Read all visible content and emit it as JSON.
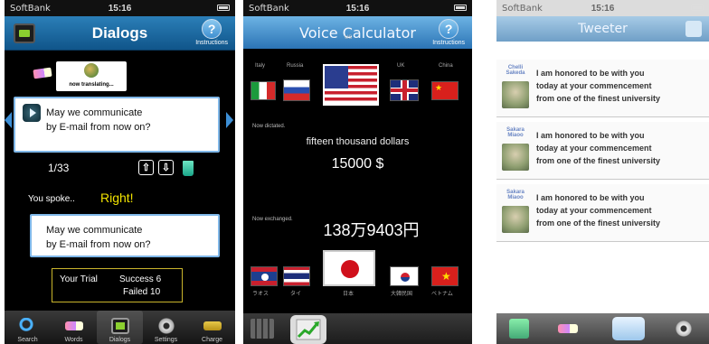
{
  "phone1": {
    "status": {
      "carrier": "SoftBank",
      "time": "15:16"
    },
    "navbar": {
      "title": "Dialogs",
      "help_label": "Instructions",
      "help_glyph": "?"
    },
    "translating_label": "now translating...",
    "dialog_text": [
      "May we communicate",
      "by E-mail from now on?"
    ],
    "counter": "1/33",
    "action_glyphs": {
      "upload": "⇧",
      "download": "⇩"
    },
    "spoke_label": "You spoke..",
    "spoke_result": "Right!",
    "spoken_text": [
      "May we communicate",
      "by E-mail from now on?"
    ],
    "trial": {
      "label": "Your Trial",
      "success": "Success  6",
      "failed": "Failed   10"
    },
    "tabs": [
      {
        "label": "Search",
        "icon": "magnifier-icon",
        "selected": false
      },
      {
        "label": "Words",
        "icon": "pencil-eraser-icon",
        "selected": false
      },
      {
        "label": "Dialogs",
        "icon": "dialog-monitor-icon",
        "selected": true
      },
      {
        "label": "Settings",
        "icon": "gear-icon",
        "selected": false
      },
      {
        "label": "Charge",
        "icon": "money-icon",
        "selected": false
      }
    ]
  },
  "phone2": {
    "status": {
      "carrier": "SoftBank",
      "time": "15:16"
    },
    "navbar": {
      "title": "Voice Calculator",
      "help_label": "Instructions",
      "help_glyph": "?"
    },
    "top_flags": [
      {
        "label": "Italy",
        "country": "italy"
      },
      {
        "label": "Russia",
        "country": "russia"
      },
      {
        "label": "US",
        "country": "usa"
      },
      {
        "label": "UK",
        "country": "uk"
      },
      {
        "label": "China",
        "country": "china"
      }
    ],
    "us_label": "US",
    "now_dictated": "Now dictated.",
    "words": "fifteen thousand dollars",
    "amount": "15000 $",
    "now_exchanged": "Now exchanged.",
    "amount_jp": "138万9403円",
    "bottom_flags": [
      {
        "label": "ラオス",
        "country": "laos"
      },
      {
        "label": "タイ",
        "country": "thailand"
      },
      {
        "label": "日本",
        "country": "japan"
      },
      {
        "label": "大韓民国",
        "country": "korea"
      },
      {
        "label": "ベトナム",
        "country": "vietnam"
      }
    ]
  },
  "phone3": {
    "status": {
      "carrier": "SoftBank",
      "time": "15:16"
    },
    "navbar": {
      "title": "Tweeter"
    },
    "tweets": [
      {
        "user": "Chelli Sakeda",
        "text": [
          "I am honored to be with you",
          "today at your commencement",
          "from one of the finest university"
        ]
      },
      {
        "user": "Sakara Miaoo",
        "text": [
          "I am honored to be with you",
          "today at your commencement",
          "from one of the finest university"
        ]
      },
      {
        "user": "Sakara Miaoo",
        "text": [
          "I am honored to be with you",
          "today at your commencement",
          "from one of the finest university"
        ]
      }
    ]
  },
  "colors": {
    "nav_blue": "#2b7fb8",
    "bubble_border": "#7fb7e8",
    "right_yellow": "#f2e300",
    "trial_border": "#c9b52c"
  }
}
